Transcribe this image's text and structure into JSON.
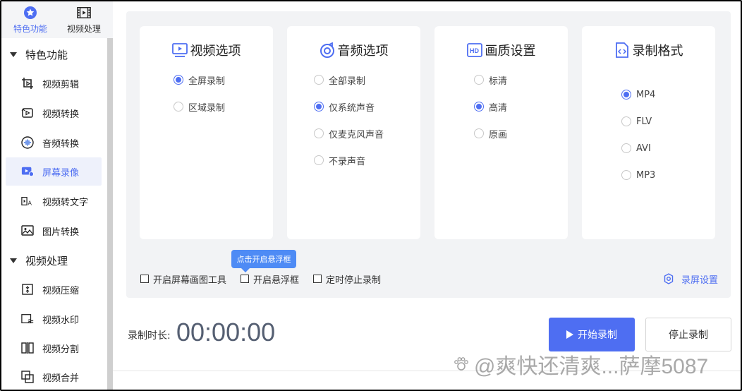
{
  "sidebar": {
    "tabs": [
      {
        "label": "特色功能",
        "icon": "star-icon",
        "active": true
      },
      {
        "label": "视频处理",
        "icon": "film-icon",
        "active": false
      }
    ],
    "groups": [
      {
        "label": "特色功能"
      },
      {
        "label": "视频处理"
      }
    ],
    "items": [
      {
        "label": "视频剪辑",
        "icon": "crop-video-icon"
      },
      {
        "label": "视频转换",
        "icon": "convert-video-icon"
      },
      {
        "label": "音频转换",
        "icon": "audio-wave-icon"
      },
      {
        "label": "屏幕录像",
        "icon": "screen-record-icon",
        "active": true
      },
      {
        "label": "视频转文字",
        "icon": "video-to-text-icon"
      },
      {
        "label": "图片转换",
        "icon": "image-convert-icon"
      },
      {
        "label": "视频压缩",
        "icon": "compress-icon"
      },
      {
        "label": "视频水印",
        "icon": "watermark-icon"
      },
      {
        "label": "视频分割",
        "icon": "split-icon"
      },
      {
        "label": "视频合并",
        "icon": "merge-icon"
      }
    ]
  },
  "cards": {
    "video": {
      "title": "视频选项",
      "icon": "video-play-icon",
      "options": [
        {
          "label": "全屏录制",
          "selected": true
        },
        {
          "label": "区域录制",
          "selected": false
        }
      ]
    },
    "audio": {
      "title": "音频选项",
      "icon": "audio-disc-icon",
      "options": [
        {
          "label": "全部录制",
          "selected": false
        },
        {
          "label": "仅系统声音",
          "selected": true
        },
        {
          "label": "仅麦克风声音",
          "selected": false
        },
        {
          "label": "不录声音",
          "selected": false
        }
      ]
    },
    "quality": {
      "title": "画质设置",
      "icon": "hd-icon",
      "options": [
        {
          "label": "标清",
          "selected": false
        },
        {
          "label": "高清",
          "selected": true
        },
        {
          "label": "原画",
          "selected": false
        }
      ]
    },
    "format": {
      "title": "录制格式",
      "icon": "code-file-icon",
      "options": [
        {
          "label": "MP4",
          "selected": true
        },
        {
          "label": "FLV",
          "selected": false
        },
        {
          "label": "AVI",
          "selected": false
        },
        {
          "label": "MP3",
          "selected": false
        }
      ]
    }
  },
  "checkboxes": {
    "draw_tool": "开启屏幕画图工具",
    "float_window": "开启悬浮框",
    "timer_stop": "定时停止录制"
  },
  "tooltip": "点击开启悬浮框",
  "settings_link": "录屏设置",
  "duration": {
    "label": "录制时长:",
    "value": "00:00:00"
  },
  "buttons": {
    "start": "开始录制",
    "stop": "停止录制"
  },
  "watermark": "@爽快还清爽...萨摩5087",
  "colors": {
    "accent": "#4e6ef2",
    "tooltip": "#4e8bf5",
    "panel_bg": "#f2f3f5"
  }
}
